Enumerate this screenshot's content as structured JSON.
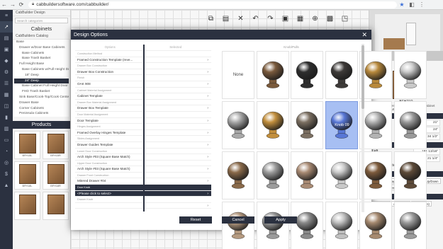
{
  "browser": {
    "url": "cabbuildersoftware.com/cabbuilder/"
  },
  "left_panel": {
    "app_label": "CabBuilder Design",
    "search_placeholder": "Search categories",
    "title": "Cabinets",
    "catalog_label": "CabBuilders Catalog",
    "tree": [
      "Base",
      "Drawer w/Door Base Cabinets",
      "Base Cabinets",
      "Base Trash Basket",
      "Full Height Base",
      "Base Cabinets w/Full Height Door",
      "18\" Deep",
      "24\" Deep",
      "Base Cabinet Full Height Door w/...",
      "FHD Trash Basket",
      "Sink Base/Cook-Top/Cook Center",
      "Drawer Base",
      "Corner Cabinets",
      "Peninsula Cabinets"
    ],
    "tree_selected_index": 7,
    "products_title": "Products",
    "products": [
      "BFH15L",
      "BFH15R",
      "BFH18L",
      "BFH18R",
      "",
      ""
    ]
  },
  "modal": {
    "title": "Design Options",
    "options_header": "Options",
    "selected_header": "Selected",
    "knobs_header": "Knob/Pulls",
    "options": [
      {
        "name": "Construction Method",
        "value": "Framed Construction Template (reve..."
      },
      {
        "name": "Drawer Box Construction",
        "value": "Drawer Box Construction"
      },
      {
        "name": "Finish",
        "value": "OAK 908"
      },
      {
        "name": "Cabinet Material Assignment",
        "value": "Cabinet Template"
      },
      {
        "name": "Drawer Box Material Assignment",
        "value": "Drawer Box Template"
      },
      {
        "name": "Door Material Assignment",
        "value": "Door Template"
      },
      {
        "name": "Hinges Assignment",
        "value": "Framed Overlay Hinges Template"
      },
      {
        "name": "Slides Assignment",
        "value": "Drawer Guides Template"
      },
      {
        "name": "Lower Door Construction",
        "value": "Arch Style #03 (Square Base Match)"
      },
      {
        "name": "Upper Door Construction",
        "value": "Arch Style #03 (Square Base Match)"
      },
      {
        "name": "Drawer Front Construction",
        "value": "Mitered Drawer #04"
      },
      {
        "name": "Door Knob",
        "value": "<Please click to select>"
      },
      {
        "name": "Drawer Knob",
        "value": ""
      }
    ],
    "active_option_index": 11,
    "knobs": [
      {
        "label": "None",
        "color": ""
      },
      {
        "label": "",
        "color": "#7a5a3c"
      },
      {
        "label": "",
        "color": "#2e2e2e"
      },
      {
        "label": "",
        "color": "#3d3a38"
      },
      {
        "label": "",
        "color": "#b8893c"
      },
      {
        "label": "",
        "color": "#c9c9c9"
      },
      {
        "label": "",
        "color": "#a9a9a9"
      },
      {
        "label": "",
        "color": "#c28f3d"
      },
      {
        "label": "",
        "color": "#7c7062"
      },
      {
        "label": "Knob 09",
        "color": "#5877d6"
      },
      {
        "label": "",
        "color": "#b3b3b3"
      },
      {
        "label": "",
        "color": "#9a9a9a"
      },
      {
        "label": "",
        "color": "#8a6a4a"
      },
      {
        "label": "",
        "color": "#9c9c9c"
      },
      {
        "label": "",
        "color": "#a98b74"
      },
      {
        "label": "",
        "color": "#c9c9c9"
      },
      {
        "label": "",
        "color": "#7d5b3c"
      },
      {
        "label": "",
        "color": "#5d4a38"
      },
      {
        "label": "",
        "color": "#b59a80"
      },
      {
        "label": "",
        "color": "#9a9a9a"
      },
      {
        "label": "",
        "color": "#8b8b8b"
      },
      {
        "label": "",
        "color": "#c0c0c0"
      },
      {
        "label": "",
        "color": "#a68a70"
      },
      {
        "label": "",
        "color": "#9c9c9c"
      }
    ],
    "selected_knob_index": 9,
    "buttons": {
      "reset": "Reset",
      "cancel": "Cancel",
      "apply": "Apply"
    }
  },
  "right_panel": {
    "attributes_title": "Attributes",
    "cabinet_code": "BFH21R",
    "cabinet_desc": "Base Full Height Door 24\" Deep Cabinet",
    "cabinet_sub": "CABBUILDER CATALOG",
    "properties_title": "Properties",
    "properties": [
      {
        "label": "Width",
        "value": "21\""
      },
      {
        "label": "Depth",
        "value": "24\""
      },
      {
        "label": "Height",
        "value": "34 1/2\""
      }
    ],
    "position_title": "Position",
    "position": [
      {
        "label": "Left",
        "value": "191 13/16\""
      },
      {
        "label": "Right",
        "value": "21 1/4\""
      }
    ],
    "to_back_center": "To Back Center",
    "actions_title": "Actions",
    "actions": [
      "Position",
      "Drag",
      "Move",
      "In/Out",
      "Up/Down",
      "Rotate",
      "Center"
    ],
    "text_options_title": "Text Options",
    "text_options": [
      "Move / Axis",
      "Adjust Axis",
      "Scale (Axis)"
    ]
  }
}
